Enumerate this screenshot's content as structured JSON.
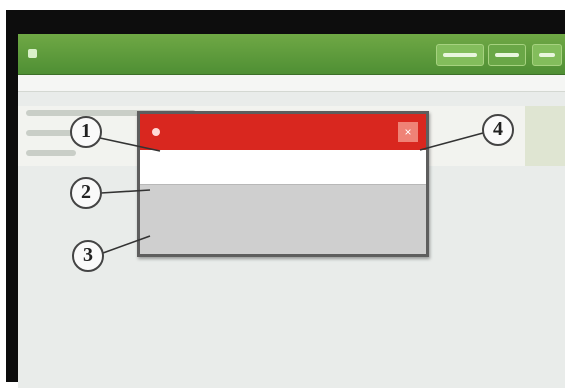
{
  "titlebar": {
    "title": ""
  },
  "menubar": {
    "items": [
      "",
      "",
      ""
    ]
  },
  "dialog": {
    "title": "",
    "close_glyph": "×",
    "message": "",
    "detail": ""
  },
  "callouts": [
    "1",
    "2",
    "3",
    "4"
  ],
  "colors": {
    "titlebar_green": "#5c9a3c",
    "dialog_header_red": "#d9271f",
    "close_button": "#ef8276"
  },
  "icons": [
    "app-icon",
    "dialog-status-icon",
    "close-icon"
  ]
}
